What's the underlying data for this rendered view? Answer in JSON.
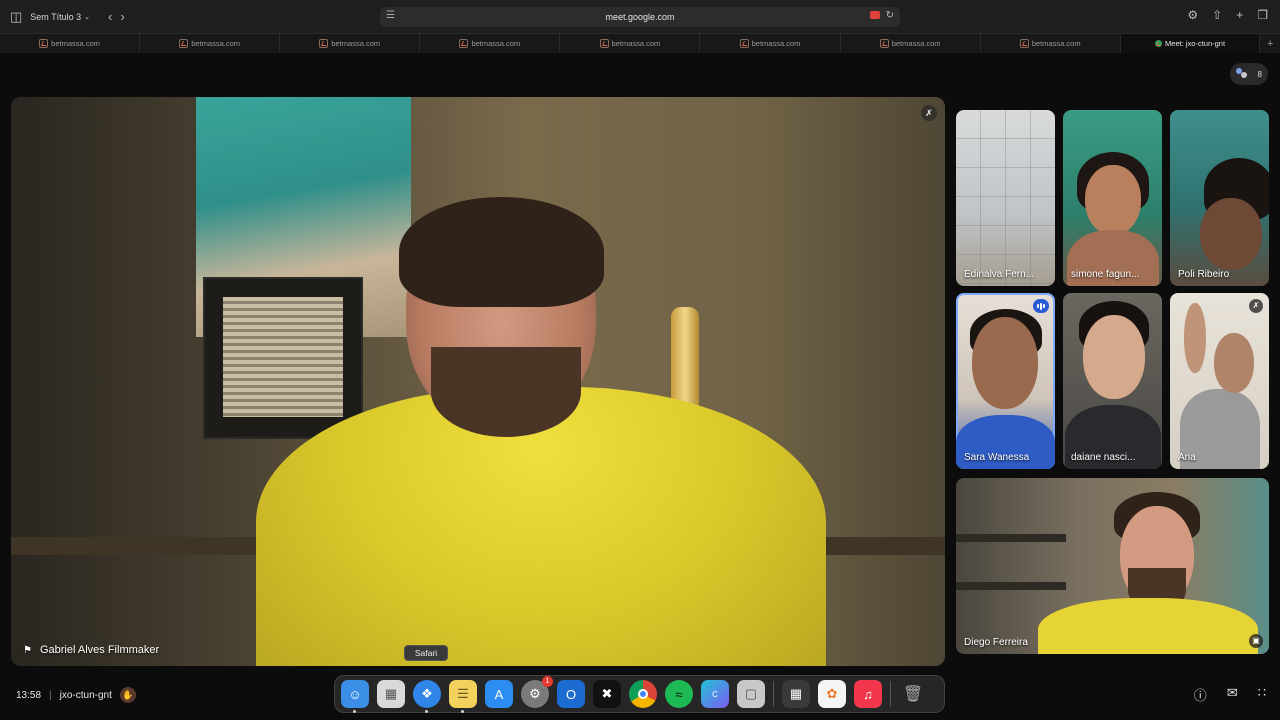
{
  "browser": {
    "tab_group_title": "Sem Título 3",
    "url": "meet.google.com",
    "tabs": [
      {
        "label": "betmassa.com"
      },
      {
        "label": "betmassa.com"
      },
      {
        "label": "betmassa.com"
      },
      {
        "label": "betmassa.com"
      },
      {
        "label": "betmassa.com"
      },
      {
        "label": "betmassa.com"
      },
      {
        "label": "betmassa.com"
      },
      {
        "label": "betmassa.com"
      }
    ],
    "active_tab": {
      "label": "Meet: jxo-ctun-gnt"
    }
  },
  "meeting": {
    "participant_count": "8",
    "main_speaker": {
      "name": "Gabriel Alves Filmmaker"
    },
    "tiles": [
      {
        "name": "Edinalva Fern..."
      },
      {
        "name": "simone fagun..."
      },
      {
        "name": "Poli Ribeiro"
      },
      {
        "name": "Sara Wanessa"
      },
      {
        "name": "daiane nasci..."
      },
      {
        "name": "Ana"
      },
      {
        "name": "Diego Ferreira"
      }
    ],
    "time": "13:58",
    "meeting_code": "jxo-ctun-gnt"
  },
  "dock": {
    "tooltip": "Safari",
    "apps": [
      {
        "name": "Finder",
        "color": "#3a8ee6"
      },
      {
        "name": "Launchpad",
        "color": "#d9d9d9"
      },
      {
        "name": "Safari",
        "color": "#2f86e8"
      },
      {
        "name": "Notes",
        "color": "#f2d15c"
      },
      {
        "name": "App Store",
        "color": "#2d8cf0"
      },
      {
        "name": "System Settings",
        "color": "#7a7a7a",
        "badge": "1"
      },
      {
        "name": "Outlook",
        "color": "#1b6bd0"
      },
      {
        "name": "CapCut",
        "color": "#111111"
      },
      {
        "name": "Chrome",
        "color": "#e9e9e9"
      },
      {
        "name": "Spotify",
        "color": "#1db954"
      },
      {
        "name": "Canva",
        "color": "#7b5cf0"
      },
      {
        "name": "Preview",
        "color": "#c8c8c8"
      },
      {
        "name": "Calculator",
        "color": "#3a3a3a"
      },
      {
        "name": "Photos",
        "color": "#f5f5f5"
      },
      {
        "name": "Music",
        "color": "#f2374c"
      },
      {
        "name": "Trash",
        "color": "#8a8a8a"
      }
    ]
  }
}
